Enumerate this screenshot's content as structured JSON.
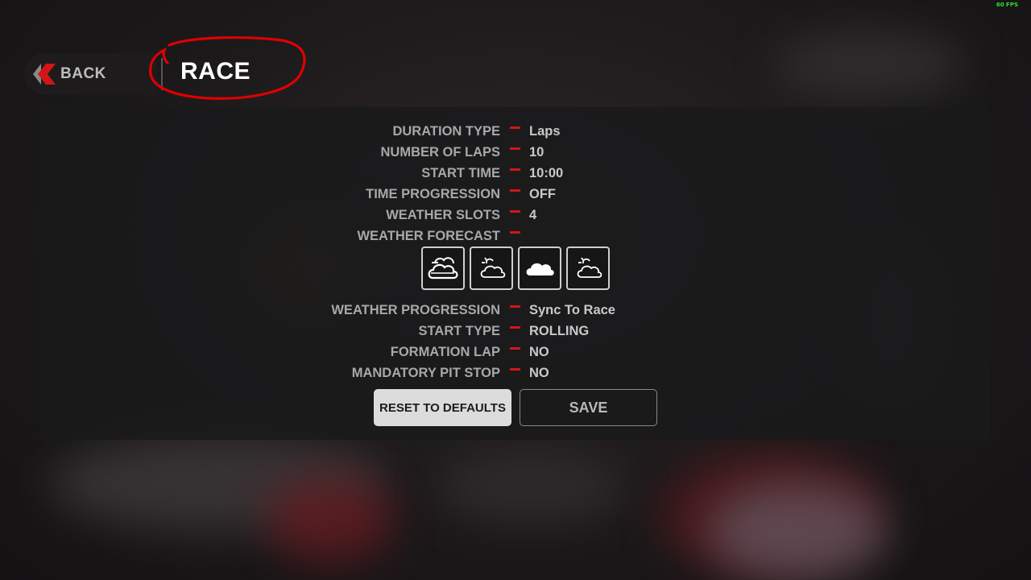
{
  "hud": {
    "fps": "60 FPS"
  },
  "header": {
    "back_label": "BACK",
    "title": "RACE"
  },
  "settings": [
    {
      "label": "DURATION TYPE",
      "value": "Laps"
    },
    {
      "label": "NUMBER OF LAPS",
      "value": "10"
    },
    {
      "label": "START TIME",
      "value": "10:00"
    },
    {
      "label": "TIME PROGRESSION",
      "value": "OFF"
    },
    {
      "label": "WEATHER SLOTS",
      "value": "4"
    },
    {
      "label": "WEATHER FORECAST",
      "value": ""
    },
    {
      "label": "WEATHER PROGRESSION",
      "value": "Sync To Race"
    },
    {
      "label": "START TYPE",
      "value": "ROLLING"
    },
    {
      "label": "FORMATION LAP",
      "value": "NO"
    },
    {
      "label": "MANDATORY PIT STOP",
      "value": "NO"
    }
  ],
  "weather_forecast": [
    {
      "icon": "overcast-icon"
    },
    {
      "icon": "partly-cloudy-icon"
    },
    {
      "icon": "cloudy-icon"
    },
    {
      "icon": "partly-cloudy-icon"
    }
  ],
  "buttons": {
    "reset": "RESET TO DEFAULTS",
    "save": "SAVE"
  },
  "colors": {
    "accent": "#d01616",
    "annotation": "#e00000",
    "fps": "#2fe02f"
  }
}
